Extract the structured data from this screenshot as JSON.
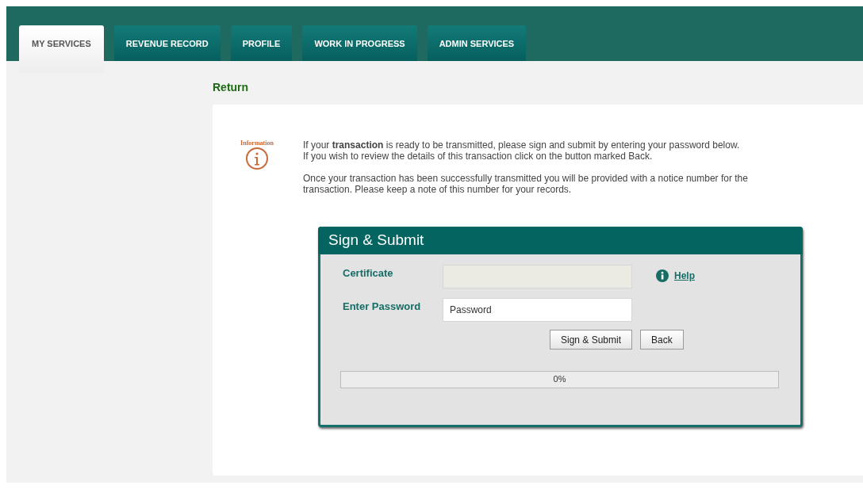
{
  "tabs": [
    {
      "label": "MY SERVICES",
      "selected": true
    },
    {
      "label": "REVENUE RECORD",
      "selected": false
    },
    {
      "label": "PROFILE",
      "selected": false
    },
    {
      "label": "WORK IN PROGRESS",
      "selected": false
    },
    {
      "label": "ADMIN SERVICES",
      "selected": false
    }
  ],
  "page_title": "Return",
  "info": {
    "label": "Information",
    "paragraphs": [
      "If your **transaction** is ready to be transmitted, please sign and submit by entering your password below.",
      "If you wish to review the details of this transaction click on the button marked Back.",
      "Once your transaction has been successfully transmitted you will be provided with a notice number for the transaction. Please keep a note of this number for your records."
    ]
  },
  "sign_panel": {
    "title": "Sign & Submit",
    "certificate": {
      "label": "Certificate",
      "disabled": true
    },
    "help_link": "Help",
    "password": {
      "label": "Enter Password",
      "placeholder": "Password"
    },
    "buttons": [
      "Sign & Submit",
      "Back"
    ],
    "progress": {
      "level": 0,
      "reading": "0%"
    }
  }
}
